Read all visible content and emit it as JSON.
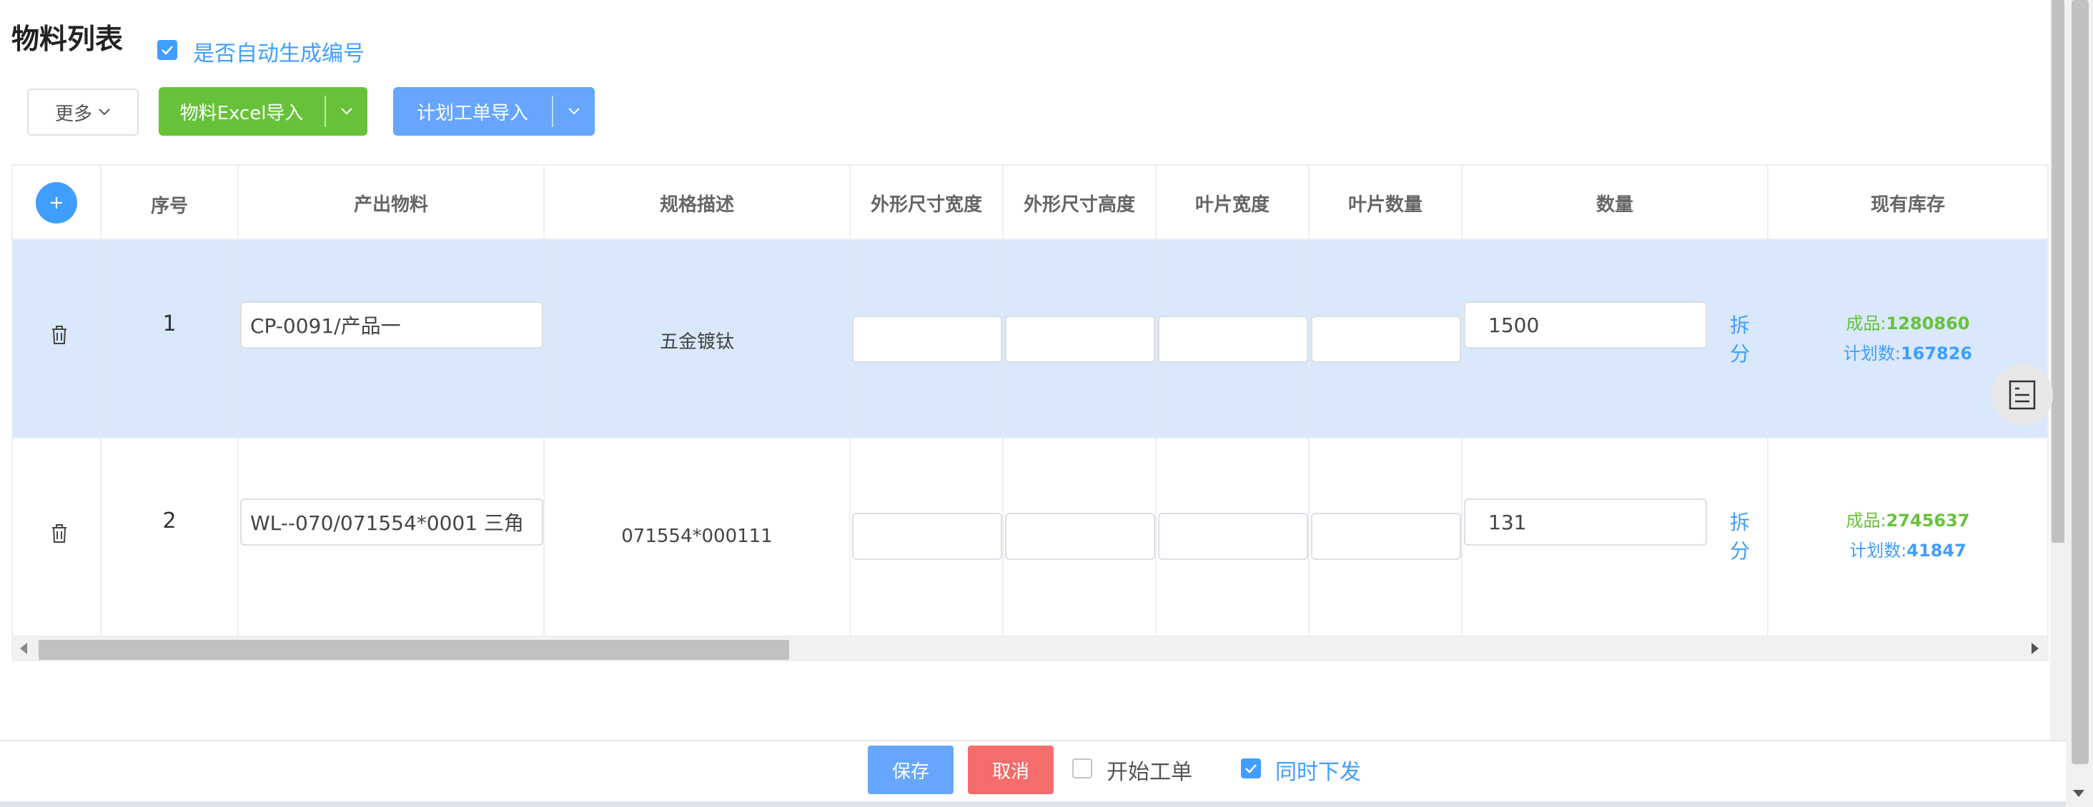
{
  "header": {
    "title": "物料列表",
    "auto_number_label": "是否自动生成编号",
    "auto_number_checked": true
  },
  "toolbar": {
    "more_label": "更多",
    "excel_import_label": "物料Excel导入",
    "plan_import_label": "计划工单导入"
  },
  "table": {
    "columns": [
      "序号",
      "产出物料",
      "规格描述",
      "外形尺寸宽度",
      "外形尺寸高度",
      "叶片宽度",
      "叶片数量",
      "数量",
      "现有库存"
    ],
    "rows": [
      {
        "seq": "1",
        "material": "CP-0091/产品一",
        "spec": "五金镀钛",
        "width": "",
        "height": "",
        "blade_width": "",
        "blade_count": "",
        "quantity": "1500",
        "split_label": "拆分",
        "stock_finished_label": "成品:",
        "stock_finished_value": "1280860",
        "stock_plan_label": "计划数:",
        "stock_plan_value": "167826"
      },
      {
        "seq": "2",
        "material": "WL--070/071554*0001  三角",
        "spec": "071554*000111",
        "width": "",
        "height": "",
        "blade_width": "",
        "blade_count": "",
        "quantity": "131",
        "split_label": "拆分",
        "stock_finished_label": "成品:",
        "stock_finished_value": "2745637",
        "stock_plan_label": "计划数:",
        "stock_plan_value": "41847"
      }
    ]
  },
  "footer": {
    "save_label": "保存",
    "cancel_label": "取消",
    "start_order_label": "开始工单",
    "start_order_checked": false,
    "dispatch_label": "同时下发",
    "dispatch_checked": true
  },
  "colors": {
    "primary": "#409eff",
    "success": "#67c23a",
    "danger": "#f56c6c",
    "row_highlight": "#d9e8fb"
  },
  "icons": [
    "check-icon",
    "chevron-down-icon",
    "plus-icon",
    "trash-icon",
    "document-icon"
  ]
}
